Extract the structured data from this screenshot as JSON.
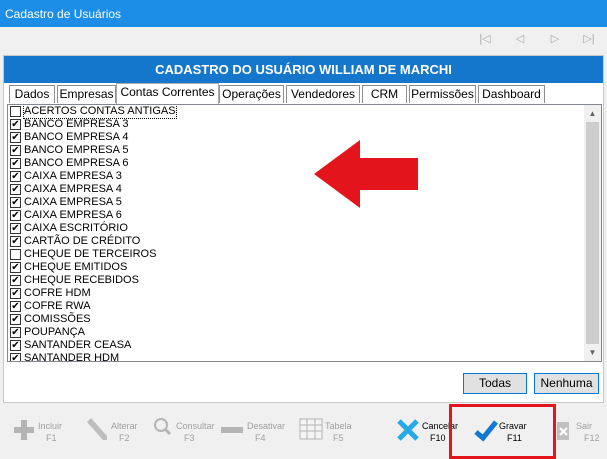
{
  "window": {
    "title": "Cadastro de Usuários"
  },
  "nav": {
    "first_icon": "first-record-icon",
    "prev_icon": "prev-record-icon",
    "next_icon": "next-record-icon",
    "last_icon": "last-record-icon"
  },
  "banner": {
    "title": "CADASTRO DO USUÁRIO WILLIAM DE MARCHI",
    "color": "#1577cc"
  },
  "tabs": [
    {
      "label": "Dados"
    },
    {
      "label": "Empresas"
    },
    {
      "label": "Contas Correntes",
      "active": true
    },
    {
      "label": "Operações"
    },
    {
      "label": "Vendedores"
    },
    {
      "label": "CRM"
    },
    {
      "label": "Permissões"
    },
    {
      "label": "Dashboard"
    }
  ],
  "accounts": [
    {
      "label": "ACERTOS CONTAS ANTIGAS",
      "checked": false
    },
    {
      "label": "BANCO EMPRESA 3",
      "checked": true
    },
    {
      "label": "BANCO EMPRESA 4",
      "checked": true
    },
    {
      "label": "BANCO EMPRESA 5",
      "checked": true
    },
    {
      "label": "BANCO EMPRESA 6",
      "checked": true
    },
    {
      "label": "CAIXA EMPRESA 3",
      "checked": true
    },
    {
      "label": "CAIXA EMPRESA 4",
      "checked": true
    },
    {
      "label": "CAIXA EMPRESA 5",
      "checked": true
    },
    {
      "label": "CAIXA EMPRESA 6",
      "checked": true
    },
    {
      "label": "CAIXA ESCRITÓRIO",
      "checked": true
    },
    {
      "label": "CARTÃO DE CRÉDITO",
      "checked": true
    },
    {
      "label": "CHEQUE DE TERCEIROS",
      "checked": false
    },
    {
      "label": "CHEQUE EMITIDOS",
      "checked": true
    },
    {
      "label": "CHEQUE RECEBIDOS",
      "checked": true
    },
    {
      "label": "COFRE HDM",
      "checked": true
    },
    {
      "label": "COFRE RWA",
      "checked": true
    },
    {
      "label": "COMISSÕES",
      "checked": true
    },
    {
      "label": "POUPANÇA",
      "checked": true
    },
    {
      "label": "SANTANDER CEASA",
      "checked": true
    },
    {
      "label": "SANTANDER HDM",
      "checked": true
    }
  ],
  "buttons": {
    "all": "Todas",
    "none": "Nenhuma"
  },
  "annotation": {
    "arrow_color": "#e3141b",
    "highlight_color": "#e3141b"
  },
  "toolbar": [
    {
      "label": "Incluir",
      "key": "F1",
      "icon": "plus-icon",
      "enabled": false
    },
    {
      "label": "Alterar",
      "key": "F2",
      "icon": "pencil-icon",
      "enabled": false
    },
    {
      "label": "Consultar",
      "key": "F3",
      "icon": "search-icon",
      "enabled": false
    },
    {
      "label": "Desativar",
      "key": "F4",
      "icon": "minus-icon",
      "enabled": false
    },
    {
      "label": "Tabela",
      "key": "F5",
      "icon": "table-icon",
      "enabled": false
    },
    {
      "label": "Cancelar",
      "key": "F10",
      "icon": "cancel-x-icon",
      "enabled": true
    },
    {
      "label": "Gravar",
      "key": "F11",
      "icon": "checkmark-icon",
      "enabled": true
    },
    {
      "label": "Sair",
      "key": "F12",
      "icon": "exit-icon",
      "enabled": false
    }
  ]
}
